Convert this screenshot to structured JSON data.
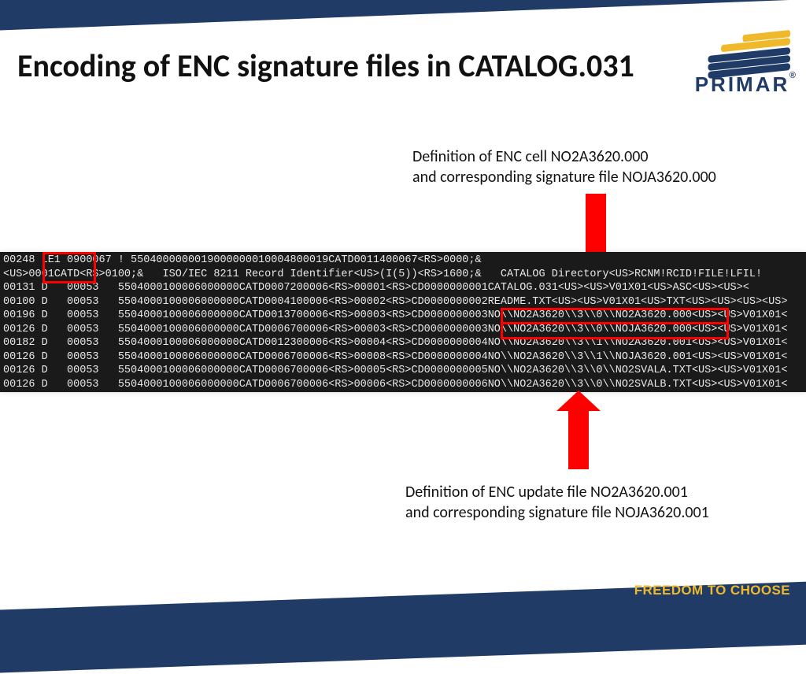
{
  "logo": {
    "name": "PRIMAR"
  },
  "title": "Encoding of ENC signature files in CATALOG.031",
  "captions": {
    "top_l1": "Definition of ENC cell NO2A3620.000",
    "top_l2": "and corresponding signature file NOJA3620.000",
    "bottom_l1": "Definition of ENC update file NO2A3620.001",
    "bottom_l2": "and corresponding signature file NOJA3620.001"
  },
  "hex": {
    "l0": "00248 LE1 0900067 ! 5504000000019000000010004800019CATD0011400067<RS>0000;&",
    "l1": "<US>0001CATD<RS>0100;&   ISO/IEC 8211 Record Identifier<US>(I(5))<RS>1600;&   CATALOG Directory<US>RCNM!RCID!FILE!LFIL!",
    "l2": "00131 D   00053   5504000100006000000CATD0007200006<RS>00001<RS>CD0000000001CATALOG.031<US><US>V01X01<US>ASC<US><US><",
    "l3": "00100 D   00053   5504000100006000000CATD0004100006<RS>00002<RS>CD0000000002README.TXT<US><US>V01X01<US>TXT<US><US><US><US>",
    "l4": "00196 D   00053   5504000100006000000CATD0013700006<RS>00003<RS>CD0000000003NO\\\\NO2A3620\\\\3\\\\0\\\\NO2A3620.000<US><US>V01X01<",
    "l5": "00126 D   00053   5504000100006000000CATD0006700006<RS>00003<RS>CD0000000003NO\\\\NO2A3620\\\\3\\\\0\\\\NOJA3620.000<US><US>V01X01<",
    "l6": "00182 D   00053   5504000100006000000CATD0012300006<RS>00004<RS>CD0000000004NO\\\\NO2A3620\\\\3\\\\1\\\\NO2A3620.001<US><US>V01X01<",
    "l7": "00126 D   00053   5504000100006000000CATD0006700006<RS>00008<RS>CD0000000004NO\\\\NO2A3620\\\\3\\\\1\\\\NOJA3620.001<US><US>V01X01<",
    "l8": "00126 D   00053   5504000100006000000CATD0006700006<RS>00005<RS>CD0000000005NO\\\\NO2A3620\\\\3\\\\0\\\\NO2SVALA.TXT<US><US>V01X01<",
    "l9": "00126 D   00053   5504000100006000000CATD0006700006<RS>00006<RS>CD0000000006NO\\\\NO2A3620\\\\3\\\\0\\\\NO2SVALB.TXT<US><US>V01X01<"
  },
  "footer": "FREEDOM TO CHOOSE"
}
